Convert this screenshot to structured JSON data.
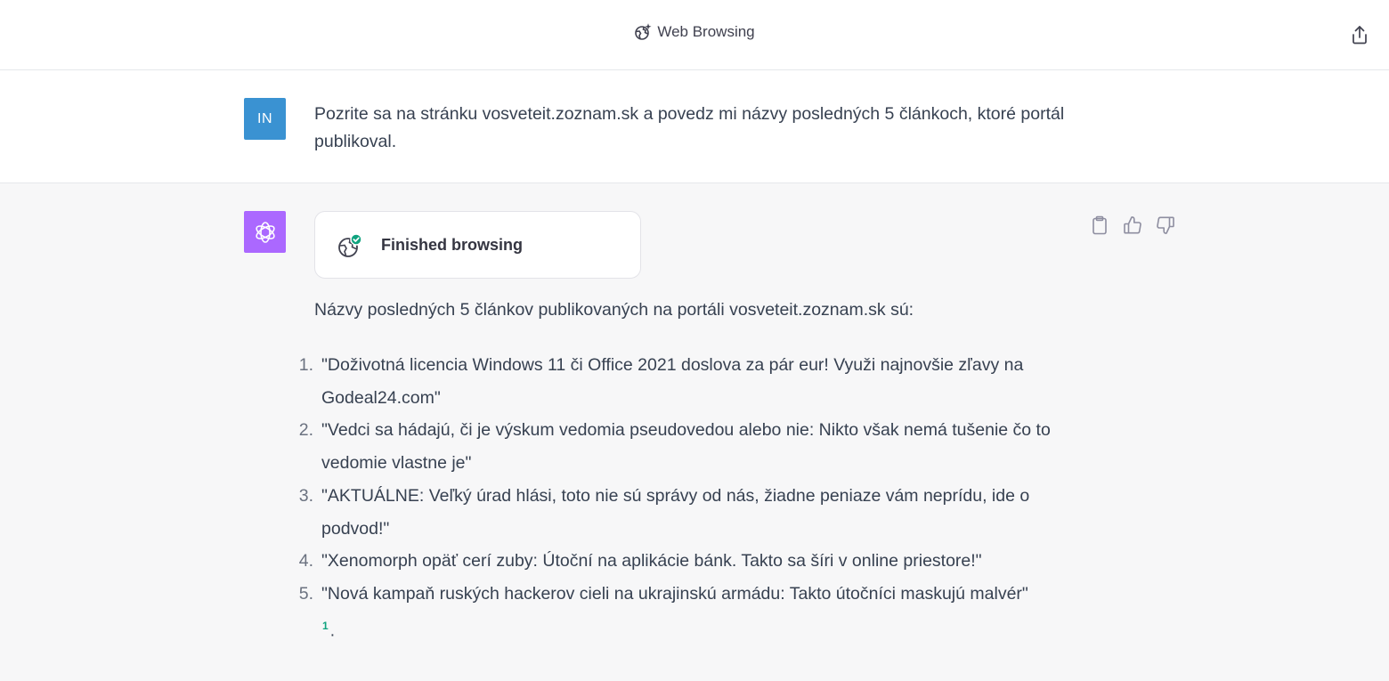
{
  "header": {
    "title": "Web Browsing",
    "icons": {
      "title_icon": "globe-sparkle-icon",
      "share": "share-icon"
    }
  },
  "user_message": {
    "avatar_initials": "IN",
    "avatar_color": "#3a92d2",
    "text": "Pozrite sa na stránku vosveteit.zoznam.sk a povedz mi názvy posledných 5 článkoch, ktoré portál publikoval."
  },
  "assistant_message": {
    "avatar_color": "#ab68ff",
    "browse_status": "Finished browsing",
    "intro": "Názvy posledných 5 článkov publikovaných na portáli vosveteit.zoznam.sk sú:",
    "items": [
      {
        "num": "1.",
        "text": "\"Doživotná licencia Windows 11 či Office 2021 doslova za pár eur! Využi najnovšie zľavy na Godeal24.com\""
      },
      {
        "num": "2.",
        "text": "\"Vedci sa hádajú, či je výskum vedomia pseudovedou alebo nie: Nikto však nemá tušenie čo to vedomie vlastne je\""
      },
      {
        "num": "3.",
        "text": "\"AKTUÁLNE: Veľký úrad hlási, toto nie sú správy od nás, žiadne peniaze vám neprídu, ide o podvod!\""
      },
      {
        "num": "4.",
        "text": "\"Xenomorph opäť cerí zuby: Útoční na aplikácie bánk. Takto sa šíri v online priestore!\""
      },
      {
        "num": "5.",
        "text": "\"Nová kampaň ruských hackerov cieli na ukrajinskú armádu: Takto útočníci maskujú malvér\""
      }
    ],
    "citation": "1",
    "trailing_period": ".",
    "actions": [
      "clipboard-icon",
      "thumbs-up-icon",
      "thumbs-down-icon"
    ],
    "status_color": "#10a37f"
  }
}
